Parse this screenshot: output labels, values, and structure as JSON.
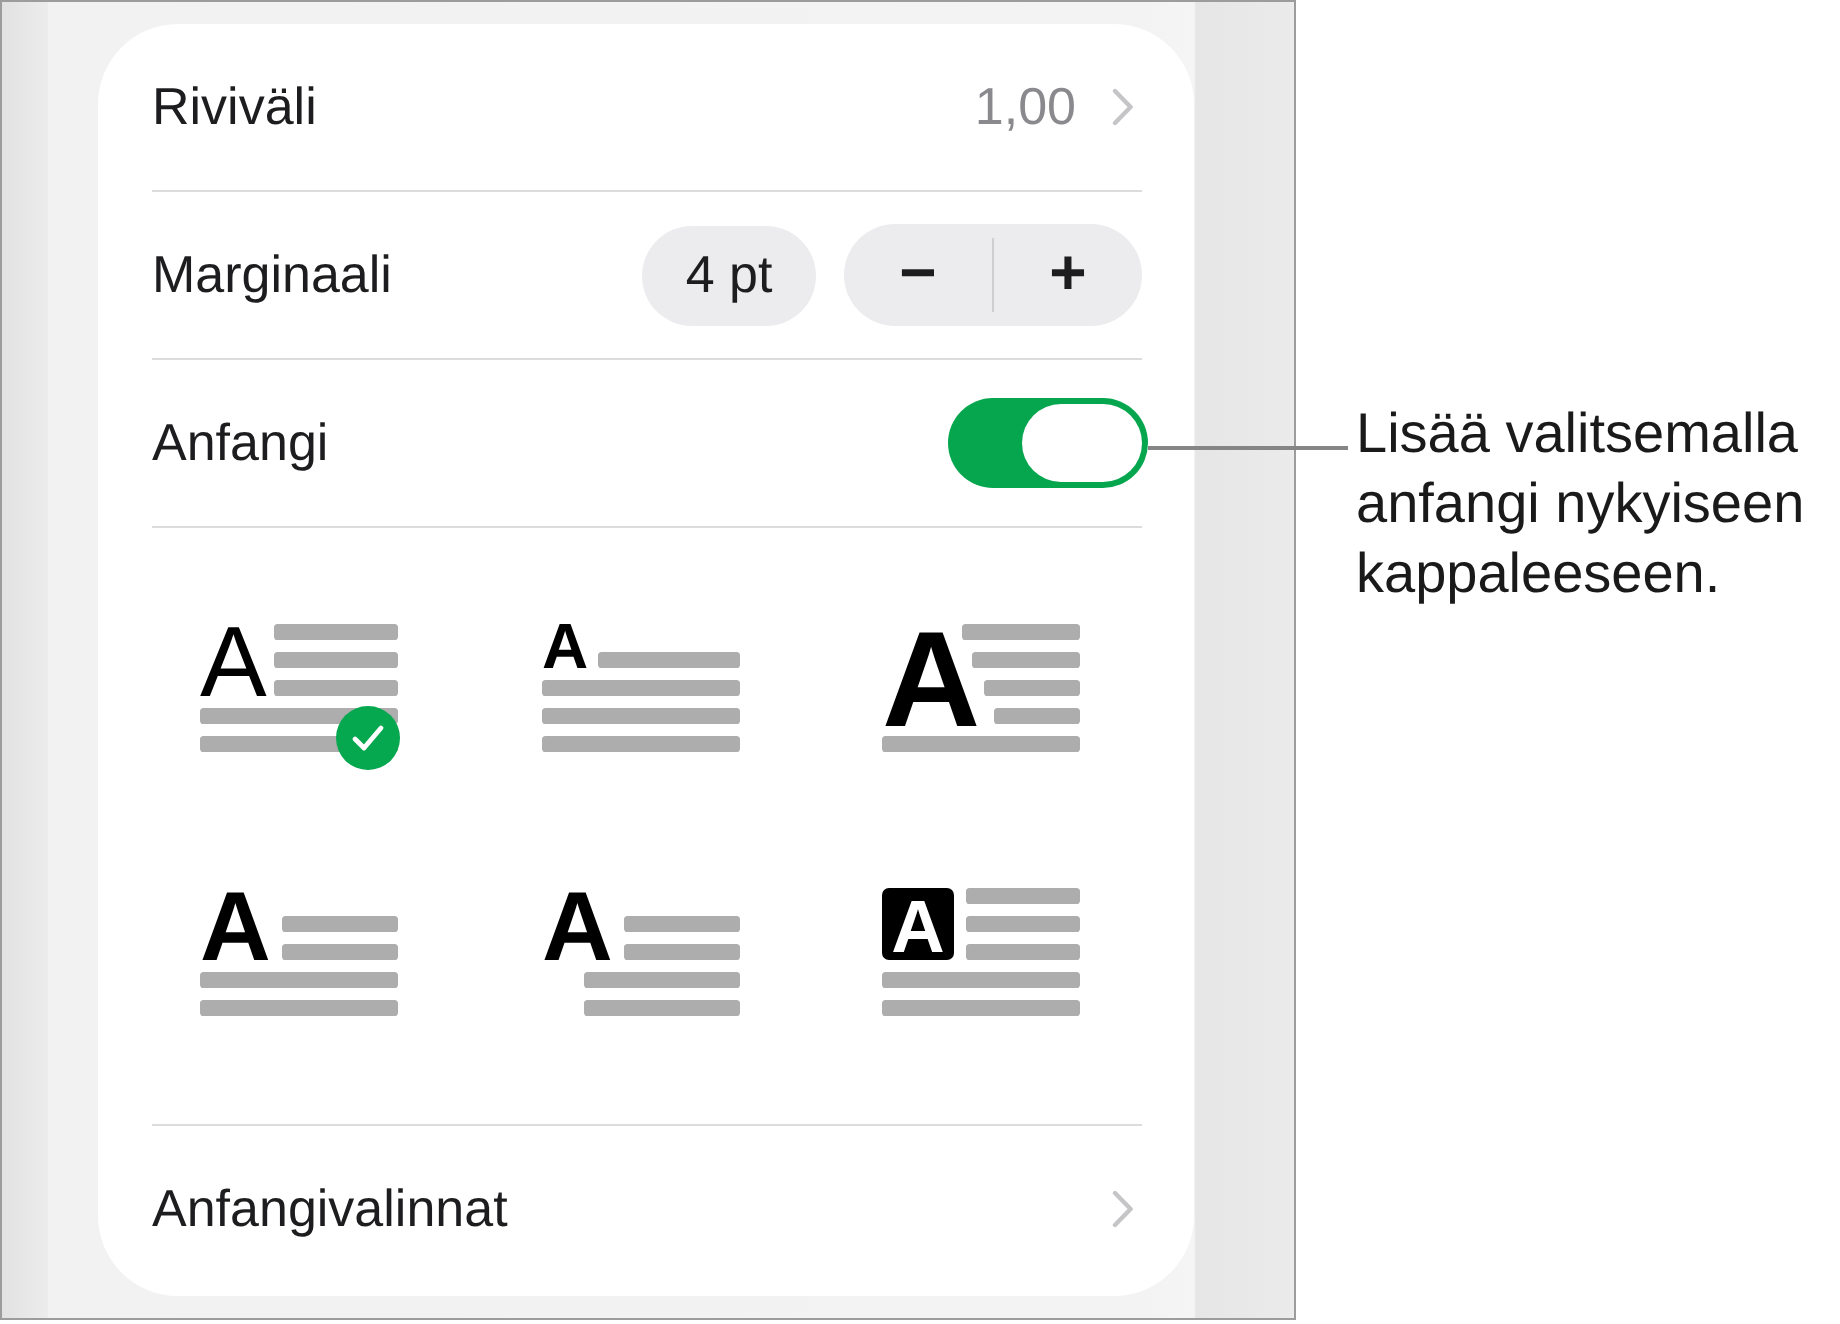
{
  "panel": {
    "rows": [
      {
        "kind": "disclosure",
        "label": "Riviväli",
        "value": "1,00"
      },
      {
        "kind": "stepper",
        "label": "Marginaali",
        "value": "4 pt",
        "decrement": "−",
        "increment": "+"
      },
      {
        "kind": "toggle",
        "label": "Anfangi",
        "on": true
      }
    ],
    "styles": [
      {
        "kind": "thin",
        "letter": "A",
        "selected": true
      },
      {
        "kind": "raised",
        "letter": "A",
        "selected": false
      },
      {
        "kind": "large",
        "letter": "A",
        "selected": false
      },
      {
        "kind": "bold",
        "letter": "A",
        "selected": false
      },
      {
        "kind": "hanging",
        "letter": "A",
        "selected": false
      },
      {
        "kind": "boxed",
        "letter": "A",
        "selected": false
      }
    ],
    "footer": {
      "label": "Anfangivalinnat"
    }
  },
  "callout": {
    "text": "Lisää valitsemalla anfangi nykyiseen kappaleeseen."
  }
}
